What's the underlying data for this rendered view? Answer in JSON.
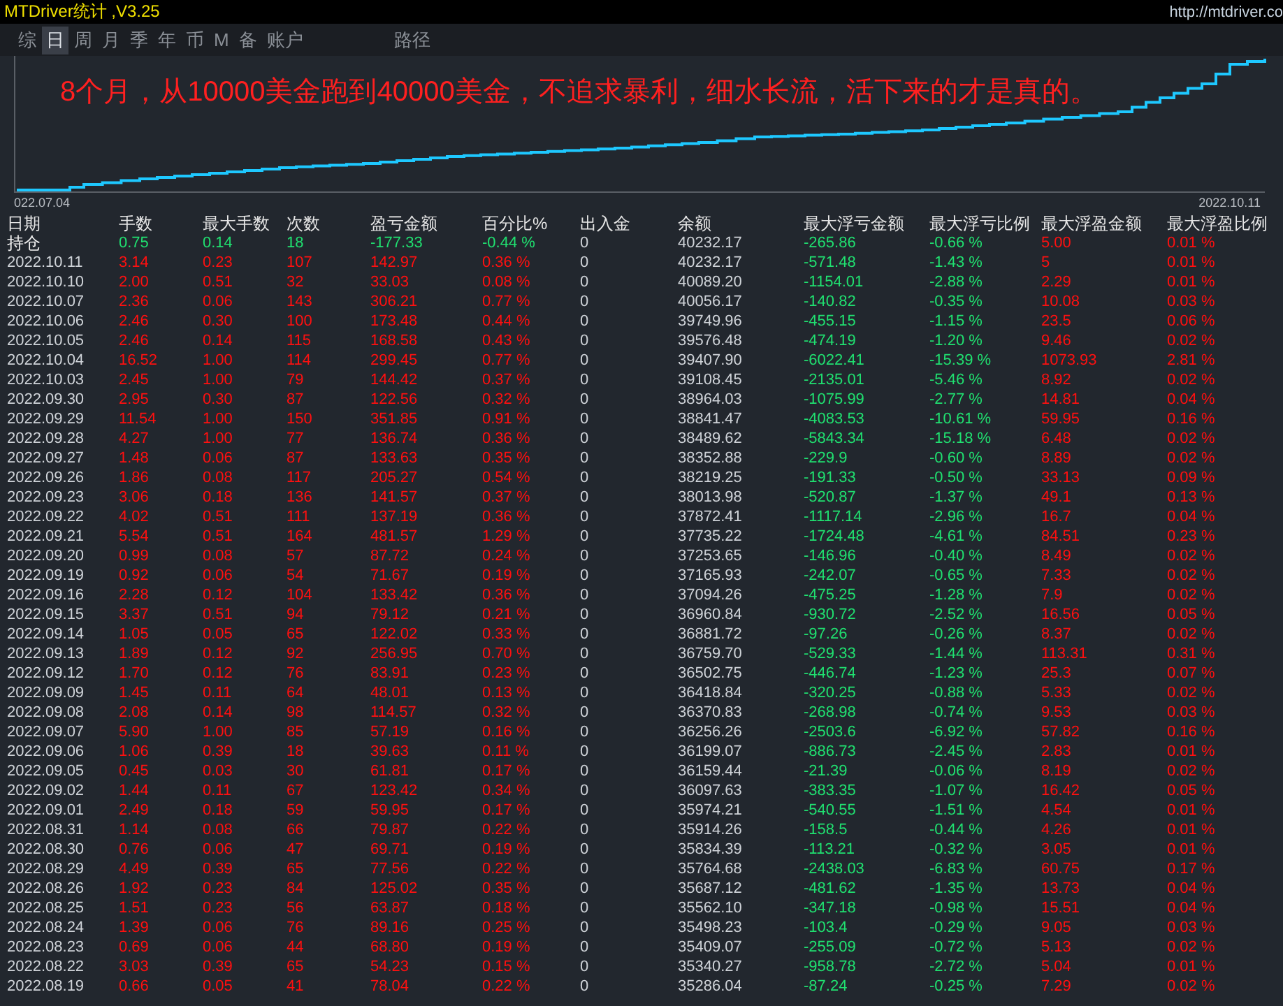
{
  "window": {
    "title": "MTDriver统计 ,V3.25",
    "url": "http://mtdriver.co"
  },
  "tabs": [
    {
      "label": "综",
      "selected": false
    },
    {
      "label": "日",
      "selected": true
    },
    {
      "label": "周",
      "selected": false
    },
    {
      "label": "月",
      "selected": false
    },
    {
      "label": "季",
      "selected": false
    },
    {
      "label": "年",
      "selected": false
    },
    {
      "label": "币",
      "selected": false
    },
    {
      "label": "M",
      "selected": false
    },
    {
      "label": "备",
      "selected": false
    },
    {
      "label": "账户",
      "selected": false
    },
    {
      "label": "路径",
      "selected": false
    }
  ],
  "chart": {
    "caption": "8个月，从10000美金跑到40000美金，不追求暴利，细水长流，活下来的才是真的。",
    "x_start_label": "022.07.04",
    "x_end_label": "2022.10.11"
  },
  "table": {
    "columns": [
      "日期",
      "手数",
      "最大手数",
      "次数",
      "盈亏金额",
      "百分比%",
      "出入金",
      "余额",
      "最大浮亏金额",
      "最大浮亏比例",
      "最大浮盈金额",
      "最大浮盈比例"
    ],
    "rows": [
      {
        "kind": "holding",
        "cells": [
          "持仓",
          "0.75",
          "0.14",
          "18",
          "-177.33",
          "-0.44 %",
          "0",
          "40232.17",
          "-265.86",
          "-0.66 %",
          "5.00",
          "0.01 %"
        ]
      },
      {
        "kind": "day",
        "cells": [
          "2022.10.11",
          "3.14",
          "0.23",
          "107",
          "142.97",
          "0.36 %",
          "0",
          "40232.17",
          "-571.48",
          "-1.43 %",
          "5",
          "0.01 %"
        ]
      },
      {
        "kind": "day",
        "cells": [
          "2022.10.10",
          "2.00",
          "0.51",
          "32",
          "33.03",
          "0.08 %",
          "0",
          "40089.20",
          "-1154.01",
          "-2.88 %",
          "2.29",
          "0.01 %"
        ]
      },
      {
        "kind": "day",
        "cells": [
          "2022.10.07",
          "2.36",
          "0.06",
          "143",
          "306.21",
          "0.77 %",
          "0",
          "40056.17",
          "-140.82",
          "-0.35 %",
          "10.08",
          "0.03 %"
        ]
      },
      {
        "kind": "day",
        "cells": [
          "2022.10.06",
          "2.46",
          "0.30",
          "100",
          "173.48",
          "0.44 %",
          "0",
          "39749.96",
          "-455.15",
          "-1.15 %",
          "23.5",
          "0.06 %"
        ]
      },
      {
        "kind": "day",
        "cells": [
          "2022.10.05",
          "2.46",
          "0.14",
          "115",
          "168.58",
          "0.43 %",
          "0",
          "39576.48",
          "-474.19",
          "-1.20 %",
          "9.46",
          "0.02 %"
        ]
      },
      {
        "kind": "day",
        "cells": [
          "2022.10.04",
          "16.52",
          "1.00",
          "114",
          "299.45",
          "0.77 %",
          "0",
          "39407.90",
          "-6022.41",
          "-15.39 %",
          "1073.93",
          "2.81 %"
        ]
      },
      {
        "kind": "day",
        "cells": [
          "2022.10.03",
          "2.45",
          "1.00",
          "79",
          "144.42",
          "0.37 %",
          "0",
          "39108.45",
          "-2135.01",
          "-5.46 %",
          "8.92",
          "0.02 %"
        ]
      },
      {
        "kind": "day",
        "cells": [
          "2022.09.30",
          "2.95",
          "0.30",
          "87",
          "122.56",
          "0.32 %",
          "0",
          "38964.03",
          "-1075.99",
          "-2.77 %",
          "14.81",
          "0.04 %"
        ]
      },
      {
        "kind": "day",
        "cells": [
          "2022.09.29",
          "11.54",
          "1.00",
          "150",
          "351.85",
          "0.91 %",
          "0",
          "38841.47",
          "-4083.53",
          "-10.61 %",
          "59.95",
          "0.16 %"
        ]
      },
      {
        "kind": "day",
        "cells": [
          "2022.09.28",
          "4.27",
          "1.00",
          "77",
          "136.74",
          "0.36 %",
          "0",
          "38489.62",
          "-5843.34",
          "-15.18 %",
          "6.48",
          "0.02 %"
        ]
      },
      {
        "kind": "day",
        "cells": [
          "2022.09.27",
          "1.48",
          "0.06",
          "87",
          "133.63",
          "0.35 %",
          "0",
          "38352.88",
          "-229.9",
          "-0.60 %",
          "8.89",
          "0.02 %"
        ]
      },
      {
        "kind": "day",
        "cells": [
          "2022.09.26",
          "1.86",
          "0.08",
          "117",
          "205.27",
          "0.54 %",
          "0",
          "38219.25",
          "-191.33",
          "-0.50 %",
          "33.13",
          "0.09 %"
        ]
      },
      {
        "kind": "day",
        "cells": [
          "2022.09.23",
          "3.06",
          "0.18",
          "136",
          "141.57",
          "0.37 %",
          "0",
          "38013.98",
          "-520.87",
          "-1.37 %",
          "49.1",
          "0.13 %"
        ]
      },
      {
        "kind": "day",
        "cells": [
          "2022.09.22",
          "4.02",
          "0.51",
          "111",
          "137.19",
          "0.36 %",
          "0",
          "37872.41",
          "-1117.14",
          "-2.96 %",
          "16.7",
          "0.04 %"
        ]
      },
      {
        "kind": "day",
        "cells": [
          "2022.09.21",
          "5.54",
          "0.51",
          "164",
          "481.57",
          "1.29 %",
          "0",
          "37735.22",
          "-1724.48",
          "-4.61 %",
          "84.51",
          "0.23 %"
        ]
      },
      {
        "kind": "day",
        "cells": [
          "2022.09.20",
          "0.99",
          "0.08",
          "57",
          "87.72",
          "0.24 %",
          "0",
          "37253.65",
          "-146.96",
          "-0.40 %",
          "8.49",
          "0.02 %"
        ]
      },
      {
        "kind": "day",
        "cells": [
          "2022.09.19",
          "0.92",
          "0.06",
          "54",
          "71.67",
          "0.19 %",
          "0",
          "37165.93",
          "-242.07",
          "-0.65 %",
          "7.33",
          "0.02 %"
        ]
      },
      {
        "kind": "day",
        "cells": [
          "2022.09.16",
          "2.28",
          "0.12",
          "104",
          "133.42",
          "0.36 %",
          "0",
          "37094.26",
          "-475.25",
          "-1.28 %",
          "7.9",
          "0.02 %"
        ]
      },
      {
        "kind": "day",
        "cells": [
          "2022.09.15",
          "3.37",
          "0.51",
          "94",
          "79.12",
          "0.21 %",
          "0",
          "36960.84",
          "-930.72",
          "-2.52 %",
          "16.56",
          "0.05 %"
        ]
      },
      {
        "kind": "day",
        "cells": [
          "2022.09.14",
          "1.05",
          "0.05",
          "65",
          "122.02",
          "0.33 %",
          "0",
          "36881.72",
          "-97.26",
          "-0.26 %",
          "8.37",
          "0.02 %"
        ]
      },
      {
        "kind": "day",
        "cells": [
          "2022.09.13",
          "1.89",
          "0.12",
          "92",
          "256.95",
          "0.70 %",
          "0",
          "36759.70",
          "-529.33",
          "-1.44 %",
          "113.31",
          "0.31 %"
        ]
      },
      {
        "kind": "day",
        "cells": [
          "2022.09.12",
          "1.70",
          "0.12",
          "76",
          "83.91",
          "0.23 %",
          "0",
          "36502.75",
          "-446.74",
          "-1.23 %",
          "25.3",
          "0.07 %"
        ]
      },
      {
        "kind": "day",
        "cells": [
          "2022.09.09",
          "1.45",
          "0.11",
          "64",
          "48.01",
          "0.13 %",
          "0",
          "36418.84",
          "-320.25",
          "-0.88 %",
          "5.33",
          "0.02 %"
        ]
      },
      {
        "kind": "day",
        "cells": [
          "2022.09.08",
          "2.08",
          "0.14",
          "98",
          "114.57",
          "0.32 %",
          "0",
          "36370.83",
          "-268.98",
          "-0.74 %",
          "9.53",
          "0.03 %"
        ]
      },
      {
        "kind": "day",
        "cells": [
          "2022.09.07",
          "5.90",
          "1.00",
          "85",
          "57.19",
          "0.16 %",
          "0",
          "36256.26",
          "-2503.6",
          "-6.92 %",
          "57.82",
          "0.16 %"
        ]
      },
      {
        "kind": "day",
        "cells": [
          "2022.09.06",
          "1.06",
          "0.39",
          "18",
          "39.63",
          "0.11 %",
          "0",
          "36199.07",
          "-886.73",
          "-2.45 %",
          "2.83",
          "0.01 %"
        ]
      },
      {
        "kind": "day",
        "cells": [
          "2022.09.05",
          "0.45",
          "0.03",
          "30",
          "61.81",
          "0.17 %",
          "0",
          "36159.44",
          "-21.39",
          "-0.06 %",
          "8.19",
          "0.02 %"
        ]
      },
      {
        "kind": "day",
        "cells": [
          "2022.09.02",
          "1.44",
          "0.11",
          "67",
          "123.42",
          "0.34 %",
          "0",
          "36097.63",
          "-383.35",
          "-1.07 %",
          "16.42",
          "0.05 %"
        ]
      },
      {
        "kind": "day",
        "cells": [
          "2022.09.01",
          "2.49",
          "0.18",
          "59",
          "59.95",
          "0.17 %",
          "0",
          "35974.21",
          "-540.55",
          "-1.51 %",
          "4.54",
          "0.01 %"
        ]
      },
      {
        "kind": "day",
        "cells": [
          "2022.08.31",
          "1.14",
          "0.08",
          "66",
          "79.87",
          "0.22 %",
          "0",
          "35914.26",
          "-158.5",
          "-0.44 %",
          "4.26",
          "0.01 %"
        ]
      },
      {
        "kind": "day",
        "cells": [
          "2022.08.30",
          "0.76",
          "0.06",
          "47",
          "69.71",
          "0.19 %",
          "0",
          "35834.39",
          "-113.21",
          "-0.32 %",
          "3.05",
          "0.01 %"
        ]
      },
      {
        "kind": "day",
        "cells": [
          "2022.08.29",
          "4.49",
          "0.39",
          "65",
          "77.56",
          "0.22 %",
          "0",
          "35764.68",
          "-2438.03",
          "-6.83 %",
          "60.75",
          "0.17 %"
        ]
      },
      {
        "kind": "day",
        "cells": [
          "2022.08.26",
          "1.92",
          "0.23",
          "84",
          "125.02",
          "0.35 %",
          "0",
          "35687.12",
          "-481.62",
          "-1.35 %",
          "13.73",
          "0.04 %"
        ]
      },
      {
        "kind": "day",
        "cells": [
          "2022.08.25",
          "1.51",
          "0.23",
          "56",
          "63.87",
          "0.18 %",
          "0",
          "35562.10",
          "-347.18",
          "-0.98 %",
          "15.51",
          "0.04 %"
        ]
      },
      {
        "kind": "day",
        "cells": [
          "2022.08.24",
          "1.39",
          "0.06",
          "76",
          "89.16",
          "0.25 %",
          "0",
          "35498.23",
          "-103.4",
          "-0.29 %",
          "9.05",
          "0.03 %"
        ]
      },
      {
        "kind": "day",
        "cells": [
          "2022.08.23",
          "0.69",
          "0.06",
          "44",
          "68.80",
          "0.19 %",
          "0",
          "35409.07",
          "-255.09",
          "-0.72 %",
          "5.13",
          "0.02 %"
        ]
      },
      {
        "kind": "day",
        "cells": [
          "2022.08.22",
          "3.03",
          "0.39",
          "65",
          "54.23",
          "0.15 %",
          "0",
          "35340.27",
          "-958.78",
          "-2.72 %",
          "5.04",
          "0.01 %"
        ]
      },
      {
        "kind": "day",
        "cells": [
          "2022.08.19",
          "0.66",
          "0.05",
          "41",
          "78.04",
          "0.22 %",
          "0",
          "35286.04",
          "-87.24",
          "-0.25 %",
          "7.29",
          "0.02 %"
        ]
      }
    ]
  }
}
